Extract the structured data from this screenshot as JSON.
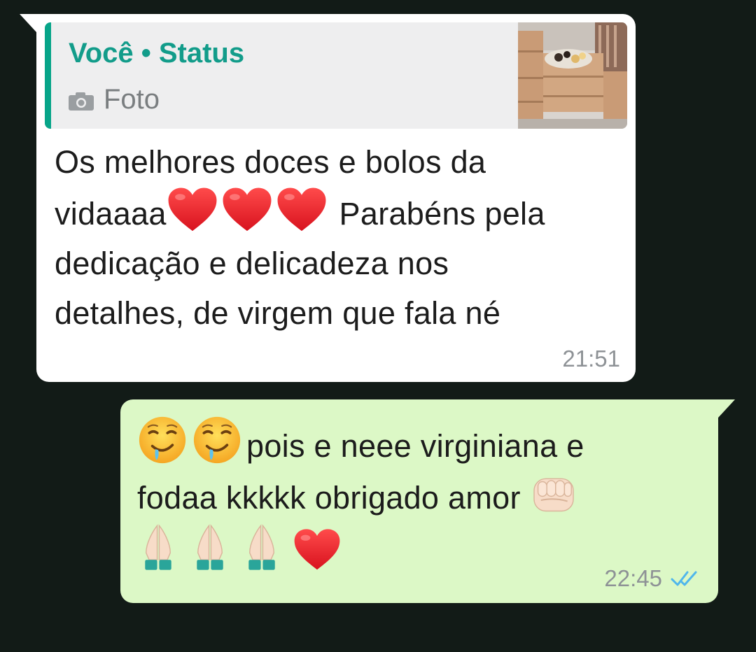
{
  "chat": {
    "incoming": {
      "quote": {
        "author": "Você • Status",
        "type_label": "Foto",
        "type_icon": "camera-icon",
        "thumbnail": "status-photo-thumbnail"
      },
      "text_lines": [
        "Os melhores doces e bolos da",
        "vidaaaa",
        "Parabéns pela",
        "dedicação e delicadeza nos",
        "detalhes, de virgem que fala né"
      ],
      "emojis": [
        "red-heart-emoji",
        "red-heart-emoji",
        "red-heart-emoji"
      ],
      "time": "21:51",
      "bubble_color": "#ffffff"
    },
    "outgoing": {
      "text_lines": [
        "pois e neee virginiana e",
        "fodaa kkkkk obrigado amor"
      ],
      "emojis": [
        "drooling-face-emoji",
        "drooling-face-emoji",
        "oncoming-fist-emoji",
        "folded-hands-emoji",
        "folded-hands-emoji",
        "folded-hands-emoji",
        "red-heart-emoji"
      ],
      "time": "22:45",
      "read_receipt": "double-check-read-icon",
      "bubble_color": "#dcf8c6"
    }
  },
  "colors": {
    "background": "#121b17",
    "accent": "#07a589",
    "read_ticks": "#4fb6ec"
  }
}
